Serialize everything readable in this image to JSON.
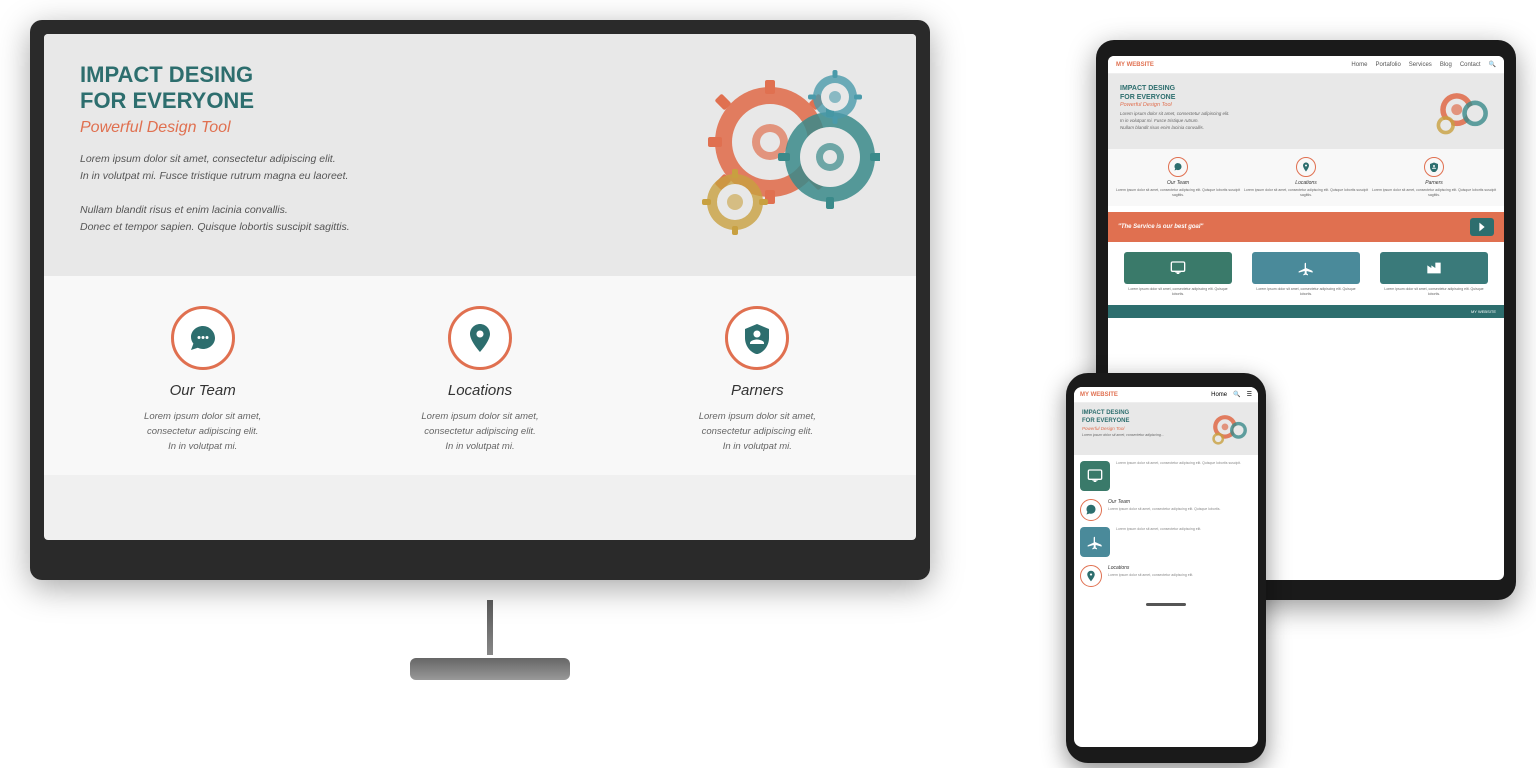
{
  "monitor": {
    "hero": {
      "title_line1": "IMPACT DESING",
      "title_line2": "FOR EVERYONE",
      "subtitle": "Powerful Design Tool",
      "para1": "Lorem ipsum dolor sit amet, consectetur adipiscing elit.",
      "para1b": "In in volutpat mi. Fusce tristique rutrum magna eu laoreet.",
      "para2": "Nullam blandit risus et enim lacinia convallis.",
      "para2b": "Donec et tempor sapien. Quisque lobortis suscipit sagittis."
    },
    "features": [
      {
        "icon": "chat",
        "title": "Our Team",
        "desc": "Lorem ipsum dolor sit amet,\nconsectetur adipiscing elit.\nIn in volutpat mi."
      },
      {
        "icon": "location",
        "title": "Locations",
        "desc": "Lorem ipsum dolor sit amet,\nconsectetur adipiscing elit.\nIn in volutpat mi."
      },
      {
        "icon": "shield",
        "title": "Parners",
        "desc": "Lorem ipsum dolor sit amet,\nconsectetur adipiscing elit.\nIn in volutpat mi."
      }
    ]
  },
  "tablet": {
    "nav": {
      "brand_my": "MY",
      "brand_website": " WEBSITE",
      "links": [
        "Home",
        "Portafolio",
        "Services",
        "Blog",
        "Contact"
      ]
    },
    "hero": {
      "title": "IMPACT DESING\nFOR EVERYONE",
      "subtitle": "Powerful Design Tool",
      "para": "Lorem ipsum dolor sit amet, consectetur adipiscing elit.\nIn in volutpat mi. Fusce tristique rutrum."
    },
    "features": [
      {
        "icon": "chat",
        "title": "Our Team",
        "desc": "Lorem ipsum dolor sit amet, consectetur adipiscing elit."
      },
      {
        "icon": "location",
        "title": "Locations",
        "desc": "Lorem ipsum dolor sit amet, consectetur adipiscing elit."
      },
      {
        "icon": "shield",
        "title": "Parners",
        "desc": "Lorem ipsum dolor sit amet, consectetur adipiscing elit."
      }
    ],
    "banner": "\"The Service is our best goal\"",
    "services": [
      {
        "icon": "monitor",
        "color": "green"
      },
      {
        "icon": "plane",
        "color": "blue"
      },
      {
        "icon": "factory",
        "color": "teal"
      }
    ],
    "footer": "MY WEBSITE"
  },
  "phone": {
    "nav": {
      "brand_my": "MY",
      "brand_website": " WEBSITE",
      "menu_icon": "☰"
    },
    "hero": {
      "title": "IMPACT DESING\nFOR EVERYONE",
      "subtitle": "Powerful Design Tool",
      "para": "Lorem ipsum dolor sit amet..."
    },
    "sections": [
      {
        "icon": "monitor",
        "color": "green",
        "title": "",
        "desc": "Lorem ipsum dolor sit amet, consectetur adipiscing elit. Quisque lobortis suscipit."
      },
      {
        "icon": "chat",
        "color": "red-circle",
        "title": "Our Team",
        "desc": "Lorem ipsum dolor sit amet, consectetur adipiscing."
      }
    ],
    "location_section": {
      "icon": "location",
      "title": "Locations",
      "desc": "Lorem ipsum dolor sit amet, consectetur adipiscing."
    },
    "plane_section": {
      "icon": "plane",
      "color": "travel"
    }
  },
  "colors": {
    "teal_dark": "#2d6e6e",
    "coral": "#e07050",
    "dark_bezel": "#1a1a1a",
    "light_bg": "#f0f0f0",
    "hero_bg": "#e8e8e8"
  }
}
